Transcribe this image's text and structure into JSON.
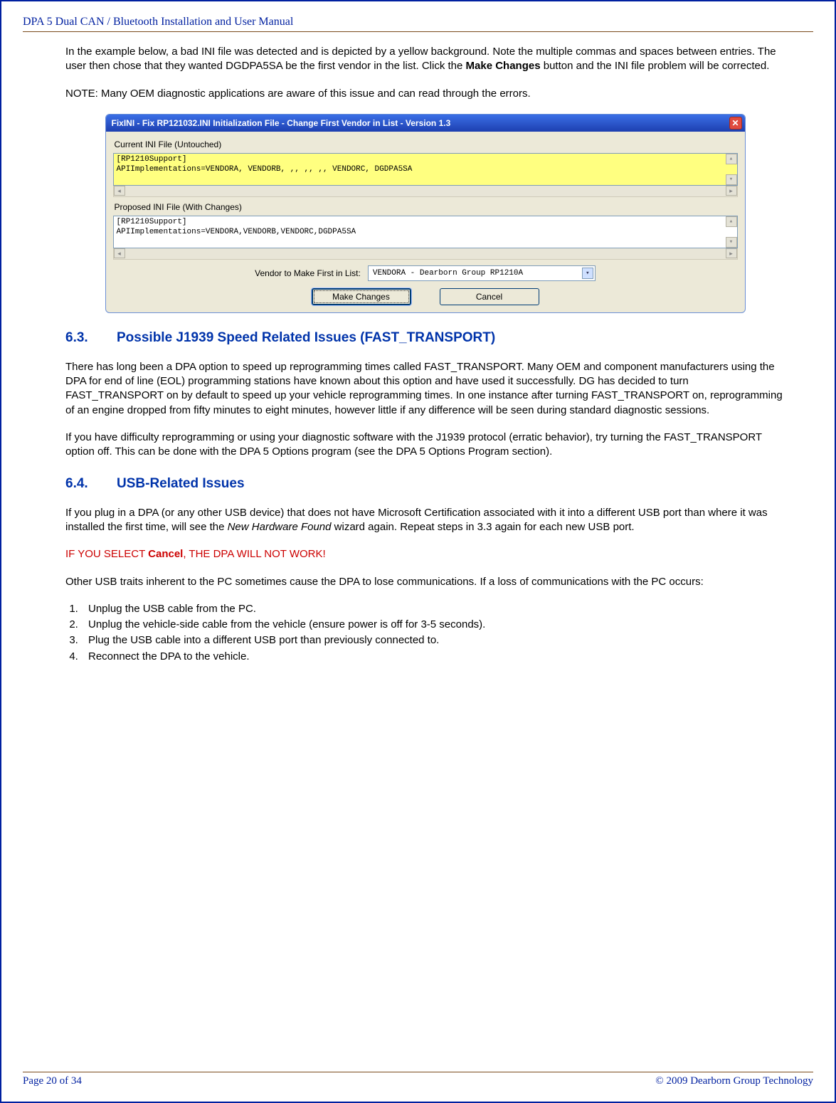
{
  "header": {
    "title": "DPA 5 Dual CAN / Bluetooth Installation and User Manual"
  },
  "intro": {
    "p1a": "In the example below, a bad INI file was detected and is depicted by a yellow background.  Note the multiple commas and spaces between entries.  The user then chose that they wanted DGDPA5SA be the first vendor in the list.  Click the ",
    "p1b": "Make Changes",
    "p1c": " button and the INI file problem will be corrected.",
    "p2": "NOTE:  Many OEM diagnostic applications are aware of this issue and can read through the errors."
  },
  "win": {
    "title": "FixINI - Fix RP121032.INI Initialization File - Change First Vendor in List - Version 1.3",
    "current_label": "Current INI File (Untouched)",
    "current_line1": "[RP1210Support]",
    "current_line2": "APIImplementations=VENDORA, VENDORB,  ,, ,, ,, VENDORC, DGDPA5SA",
    "proposed_label": "Proposed INI File (With Changes)",
    "proposed_line1": "[RP1210Support]",
    "proposed_line2": "APIImplementations=VENDORA,VENDORB,VENDORC,DGDPA5SA",
    "vendor_label": "Vendor to Make First in List:",
    "vendor_selected": "VENDORA  - Dearborn Group RP1210A",
    "btn_make": "Make Changes",
    "btn_cancel": "Cancel"
  },
  "s63": {
    "num": "6.3.",
    "title": "Possible J1939 Speed Related Issues (FAST_TRANSPORT)",
    "p1": "There has long been a DPA option to speed up reprogramming times called FAST_TRANSPORT.  Many OEM and component manufacturers using the DPA for end of line (EOL) programming stations have known about this option and have used it successfully.  DG has decided to turn FAST_TRANSPORT on by default to speed up your vehicle reprogramming times.  In one instance after turning FAST_TRANSPORT on, reprogramming of an engine dropped from fifty minutes to eight minutes, however little if any difference will be seen during standard diagnostic sessions.",
    "p2": "If you have difficulty reprogramming or using your diagnostic software with the J1939 protocol (erratic behavior), try turning the FAST_TRANSPORT option off.  This can be done with the DPA 5 Options program (see the DPA 5 Options Program section)."
  },
  "s64": {
    "num": "6.4.",
    "title": "USB-Related Issues",
    "p1a": "If you plug in a DPA (or any other USB device) that does not have Microsoft Certification associated with it into a different USB port than where it was installed the first time, will see the ",
    "p1b": "New Hardware Found",
    "p1c": " wizard again.  Repeat steps in 3.3 again for each new USB port.",
    "warn_a": "IF YOU SELECT ",
    "warn_b": "Cancel",
    "warn_c": ", THE DPA WILL NOT WORK!",
    "p3": "Other USB traits inherent to the PC sometimes cause the DPA to lose communications.  If a loss of communications with the PC occurs:",
    "steps": [
      "Unplug the USB cable from the PC.",
      "Unplug the vehicle-side cable from the vehicle (ensure power is off for 3-5 seconds).",
      "Plug the USB cable into a different USB port than previously connected to.",
      "Reconnect the DPA to the vehicle."
    ]
  },
  "footer": {
    "left": "Page 20 of 34",
    "right": "© 2009 Dearborn Group Technology"
  }
}
